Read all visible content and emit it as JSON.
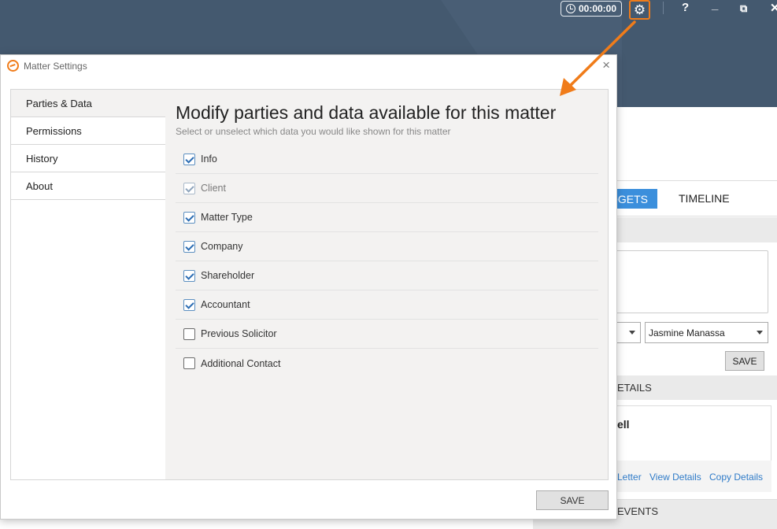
{
  "topbar": {
    "timer": "00:00:00",
    "gear_icon": "gear-icon",
    "help": "?",
    "minimize": "_",
    "restore": "⧉",
    "close": "✕"
  },
  "background": {
    "tabs": [
      "DGETS",
      "TIMELINE"
    ],
    "select_right": "Jasmine Manassa",
    "save_label": "SAVE",
    "section_details": "ETAILS",
    "card_name": "ell",
    "links": [
      "Letter",
      "View Details",
      "Copy Details"
    ],
    "section_events": "EVENTS"
  },
  "dialog": {
    "title": "Matter Settings",
    "close": "×",
    "sidebar": [
      {
        "label": "Parties & Data",
        "active": true
      },
      {
        "label": "Permissions",
        "active": false
      },
      {
        "label": "History",
        "active": false
      },
      {
        "label": "About",
        "active": false
      }
    ],
    "heading": "Modify parties and data available for this matter",
    "subheading": "Select or unselect which data you would like shown for this matter",
    "options": [
      {
        "label": "Info",
        "checked": true,
        "disabled": false
      },
      {
        "label": "Client",
        "checked": true,
        "disabled": true
      },
      {
        "label": "Matter Type",
        "checked": true,
        "disabled": false
      },
      {
        "label": "Company",
        "checked": true,
        "disabled": false
      },
      {
        "label": "Shareholder",
        "checked": true,
        "disabled": false
      },
      {
        "label": "Accountant",
        "checked": true,
        "disabled": false
      },
      {
        "label": "Previous Solicitor",
        "checked": false,
        "disabled": false
      },
      {
        "label": "Additional Contact",
        "checked": false,
        "disabled": false
      }
    ],
    "save_label": "SAVE"
  },
  "colors": {
    "header": "#44596f",
    "accent": "#f07c1a",
    "tab_active": "#3b8fdc",
    "link": "#2f7bc8"
  }
}
